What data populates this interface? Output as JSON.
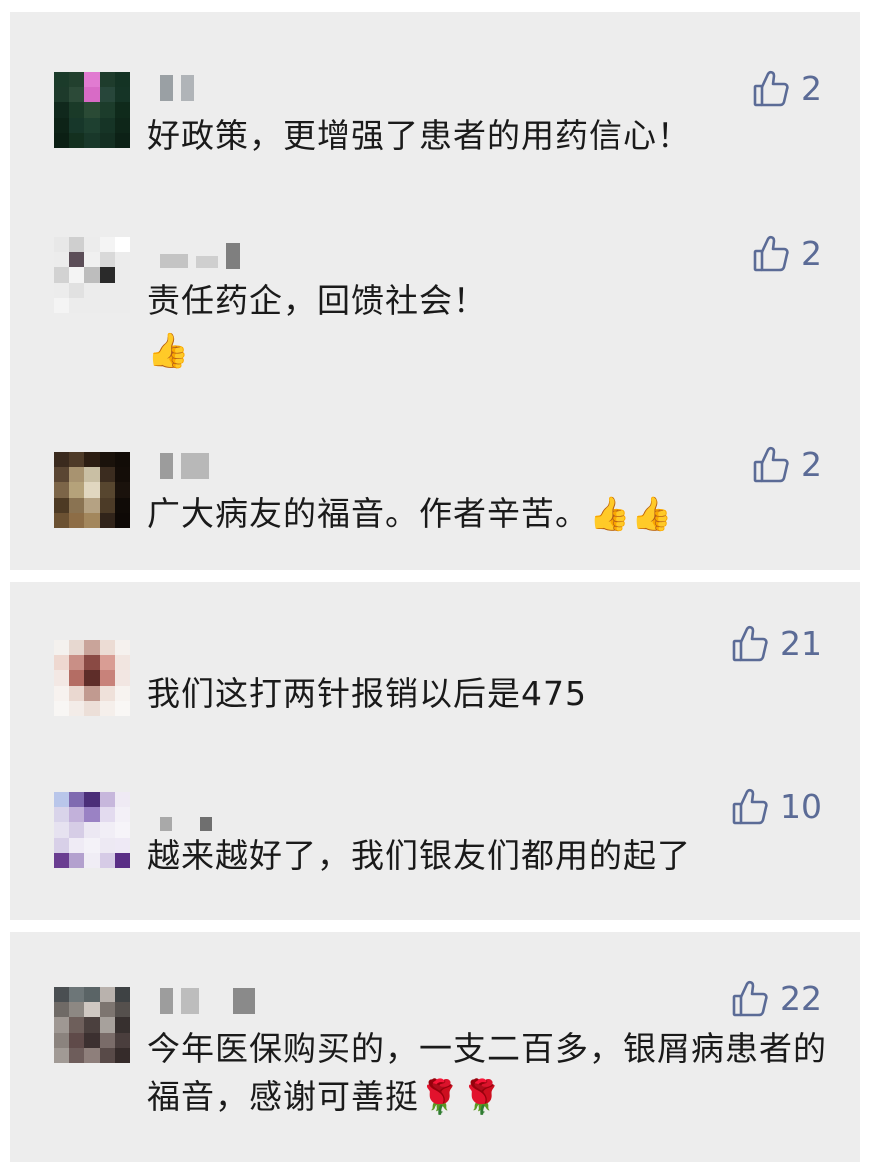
{
  "comments": [
    {
      "text": "好政策，更增强了患者的用药信心！",
      "likes": "2",
      "emoji": "",
      "avatar_colors": [
        "#1b3b2a",
        "#22402e",
        "#e17bd1",
        "#1e3c2c",
        "#143324",
        "#1d3a2b",
        "#2c4a38",
        "#d86bc6",
        "#27463a",
        "#153426",
        "#10281c",
        "#1a3a28",
        "#2a4a35",
        "#1c3c2b",
        "#0f2a1b",
        "#0d2317",
        "#17372a",
        "#1e4030",
        "#163426",
        "#0e2619",
        "#0b1f14",
        "#13301f",
        "#19382a",
        "#142f22",
        "#0c2116"
      ]
    },
    {
      "text": "责任药企，回馈社会！",
      "likes": "2",
      "emoji": "👍",
      "avatar_colors": [
        "#e8e8e8",
        "#cfcfcf",
        "#ececec",
        "#f4f4f4",
        "#ffffff",
        "#ececec",
        "#5c4e58",
        "#f0f0f0",
        "#d9d9d9",
        "#ececec",
        "#d2d2d2",
        "#f4f4f4",
        "#bdbdbd",
        "#2a2a2a",
        "#ececec",
        "#ececec",
        "#e1e1e1",
        "#ececec",
        "#ececec",
        "#ececec",
        "#f4f4f4",
        "#ececec",
        "#ececec",
        "#ececec",
        "#ececec"
      ]
    },
    {
      "text": "广大病友的福音。作者辛苦。👍👍",
      "likes": "2",
      "emoji": "",
      "avatar_colors": [
        "#3a2a1e",
        "#4e3a28",
        "#2c1d12",
        "#1a120b",
        "#120c07",
        "#5a4633",
        "#a89370",
        "#c9bfa4",
        "#3b2c1f",
        "#140d08",
        "#7c6548",
        "#b5a27a",
        "#e1d7c0",
        "#57462f",
        "#1a120c",
        "#4d3a24",
        "#8a7352",
        "#b5a283",
        "#4c3b27",
        "#100b07",
        "#6b5132",
        "#8d6d46",
        "#a3875d",
        "#31241a",
        "#0e0906"
      ]
    },
    {
      "text": "我们这打两针报销以后是475",
      "likes": "21",
      "emoji": "",
      "avatar_colors": [
        "#f4f1ee",
        "#e7d8d0",
        "#c9a49a",
        "#ecdcd4",
        "#f5f1ee",
        "#eed8d0",
        "#c98f86",
        "#8a4a44",
        "#d99d94",
        "#f1e5e0",
        "#f3e8e4",
        "#b46d64",
        "#5e2d29",
        "#c8827a",
        "#f2e6e2",
        "#f7f2ef",
        "#ead8d0",
        "#c19a90",
        "#efe1da",
        "#f7f3f0",
        "#f8f6f4",
        "#f3ece8",
        "#ecdfd8",
        "#f5efeb",
        "#f9f7f5"
      ]
    },
    {
      "text": "越来越好了，我们银友们都用的起了",
      "likes": "10",
      "emoji": "",
      "avatar_colors": [
        "#b9c6ea",
        "#7f6ab0",
        "#4b2e78",
        "#c7b7dc",
        "#efeaf4",
        "#d9d4ea",
        "#c2b1da",
        "#9a82c4",
        "#e3dbef",
        "#f3f0f7",
        "#e6e2f0",
        "#d6cde6",
        "#ece8f3",
        "#f1eef6",
        "#f6f4f9",
        "#d8d0e8",
        "#efebf5",
        "#f4f2f8",
        "#ede9f3",
        "#eee9f5",
        "#6a3d91",
        "#b3a0ce",
        "#f0edf5",
        "#d6cbe6",
        "#5a2e86"
      ]
    },
    {
      "text": "今年医保购买的，一支二百多，银屑病患者的福音，感谢可善挺🌹🌹",
      "likes": "22",
      "emoji": "",
      "avatar_colors": [
        "#4a4f52",
        "#6d7678",
        "#5a6466",
        "#b9b2ad",
        "#3e4244",
        "#6f6a66",
        "#8d8883",
        "#cfc8c2",
        "#7d7570",
        "#55504d",
        "#9f9893",
        "#6e5f5b",
        "#4b403e",
        "#a7a19c",
        "#37302f",
        "#8b837e",
        "#5f4a49",
        "#3c3030",
        "#7a6c69",
        "#4a3e3d",
        "#a19a95",
        "#6e5d5b",
        "#8e7f7b",
        "#584a48",
        "#352b2a"
      ]
    }
  ]
}
